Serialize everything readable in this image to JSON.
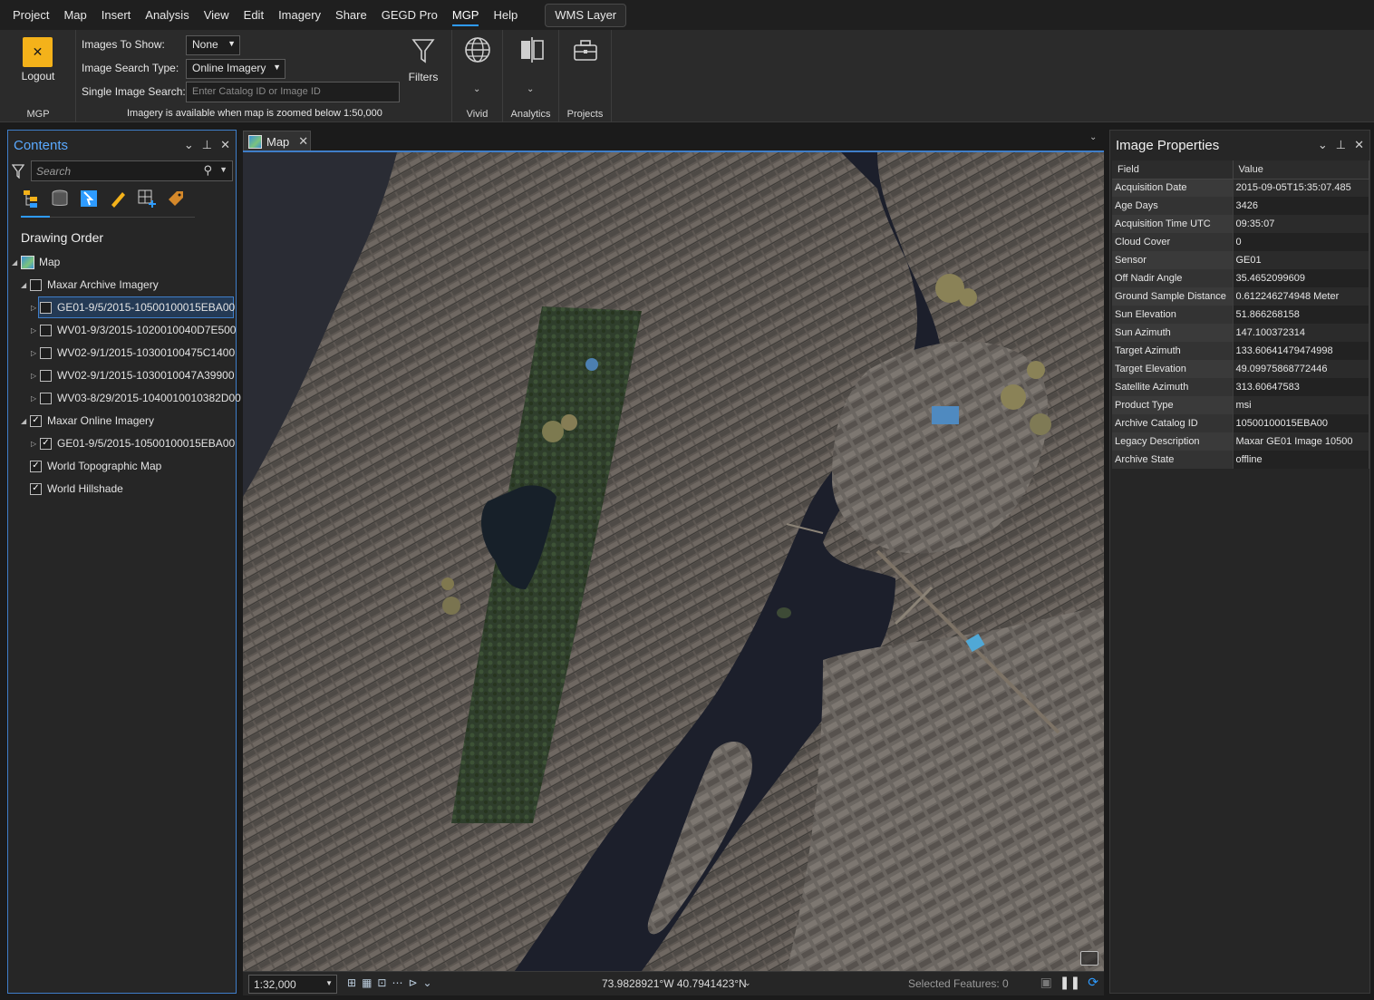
{
  "menu": {
    "items": [
      "Project",
      "Map",
      "Insert",
      "Analysis",
      "View",
      "Edit",
      "Imagery",
      "Share",
      "GEGD Pro",
      "MGP",
      "Help"
    ],
    "active": "MGP",
    "context_tab": "WMS Layer"
  },
  "ribbon": {
    "logout_label": "Logout",
    "mgp_group_label": "MGP",
    "images_to_show_label": "Images To Show:",
    "images_to_show_value": "None",
    "image_search_type_label": "Image Search Type:",
    "image_search_type_value": "Online Imagery",
    "single_image_search_label": "Single Image Search:",
    "single_image_search_placeholder": "Enter Catalog ID or Image ID",
    "zoom_note": "Imagery is available when map is zoomed below 1:50,000",
    "filters_label": "Filters",
    "vivid_label": "Vivid",
    "analytics_label": "Analytics",
    "projects_label": "Projects"
  },
  "contents": {
    "title": "Contents",
    "search_placeholder": "Search",
    "drawing_order": "Drawing Order",
    "map_label": "Map",
    "layers": [
      {
        "label": "Maxar Archive Imagery",
        "checked": false
      },
      {
        "label": "GE01-9/5/2015-10500100015EBA00",
        "checked": false
      },
      {
        "label": "WV01-9/3/2015-1020010040D7E500",
        "checked": false
      },
      {
        "label": "WV02-9/1/2015-10300100475C1400",
        "checked": false
      },
      {
        "label": "WV02-9/1/2015-1030010047A39900",
        "checked": false
      },
      {
        "label": "WV03-8/29/2015-1040010010382D00",
        "checked": false
      },
      {
        "label": "Maxar Online Imagery",
        "checked": true
      },
      {
        "label": "GE01-9/5/2015-10500100015EBA00",
        "checked": true
      },
      {
        "label": "World Topographic Map",
        "checked": true
      },
      {
        "label": "World Hillshade",
        "checked": true
      }
    ]
  },
  "map": {
    "tab_label": "Map",
    "scale": "1:32,000",
    "coordinates": "73.9828921°W 40.7941423°N",
    "selected_features": "Selected Features: 0"
  },
  "properties": {
    "title": "Image Properties",
    "col_field": "Field",
    "col_value": "Value",
    "rows": [
      {
        "field": "Acquisition Date",
        "value": "2015-09-05T15:35:07.485"
      },
      {
        "field": "Age Days",
        "value": "3426"
      },
      {
        "field": "Acquisition Time UTC",
        "value": "09:35:07"
      },
      {
        "field": "Cloud Cover",
        "value": "0"
      },
      {
        "field": "Sensor",
        "value": "GE01"
      },
      {
        "field": "Off Nadir Angle",
        "value": "35.4652099609"
      },
      {
        "field": "Ground Sample Distance",
        "value": "0.612246274948 Meter"
      },
      {
        "field": "Sun Elevation",
        "value": "51.866268158"
      },
      {
        "field": "Sun Azimuth",
        "value": "147.100372314"
      },
      {
        "field": "Target Azimuth",
        "value": "133.60641479474998"
      },
      {
        "field": "Target Elevation",
        "value": "49.09975868772446"
      },
      {
        "field": "Satellite Azimuth",
        "value": "313.60647583"
      },
      {
        "field": "Product Type",
        "value": "msi"
      },
      {
        "field": "Archive Catalog ID",
        "value": "10500100015EBA00"
      },
      {
        "field": "Legacy Description",
        "value": "Maxar GE01 Image 10500"
      },
      {
        "field": "Archive State",
        "value": "offline"
      }
    ]
  },
  "colors": {
    "accent": "#2e9bff",
    "logout_icon": "#f4b21a",
    "panel": "#262626"
  }
}
